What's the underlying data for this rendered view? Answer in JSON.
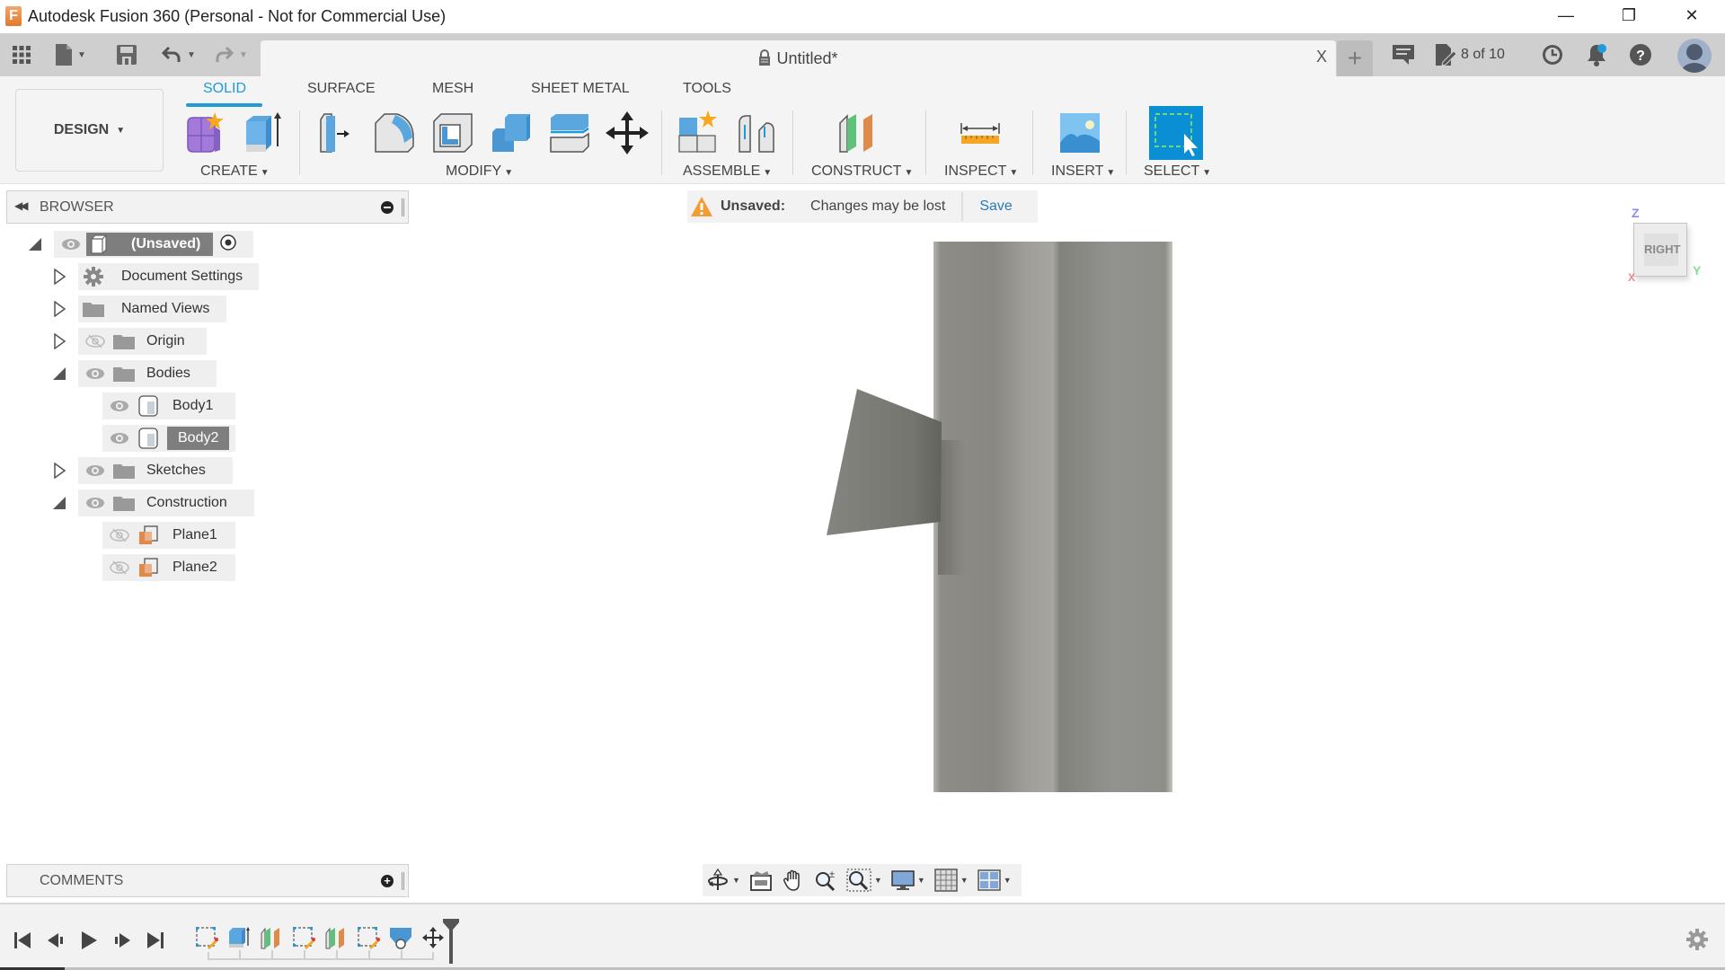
{
  "window": {
    "title": "Autodesk Fusion 360 (Personal - Not for Commercial Use)",
    "logo_letter": "F",
    "controls": {
      "minimize": "—",
      "restore": "❐",
      "close": "✕"
    }
  },
  "quick_access": {
    "icons": [
      "data-panel-grid-icon",
      "file-icon",
      "save-icon",
      "undo-icon",
      "redo-icon"
    ]
  },
  "document_tab": {
    "title": "Untitled*",
    "close": "X",
    "new_tab": "+"
  },
  "top_right": {
    "jobs_status": "8 of 10",
    "icons": [
      "comments-icon",
      "job-status-icon",
      "history-clock-icon",
      "notifications-bell-icon",
      "help-icon",
      "user-avatar"
    ]
  },
  "ribbon": {
    "workspace": "DESIGN",
    "tabs": [
      {
        "label": "SOLID",
        "active": true
      },
      {
        "label": "SURFACE",
        "active": false
      },
      {
        "label": "MESH",
        "active": false
      },
      {
        "label": "SHEET METAL",
        "active": false
      },
      {
        "label": "TOOLS",
        "active": false
      }
    ],
    "groups": [
      {
        "label": "CREATE",
        "tools": [
          "create-form-icon",
          "extrude-icon"
        ]
      },
      {
        "label": "MODIFY",
        "tools": [
          "press-pull-icon",
          "fillet-icon",
          "shell-icon",
          "combine-icon",
          "offset-face-icon",
          "move-copy-icon"
        ]
      },
      {
        "label": "ASSEMBLE",
        "tools": [
          "new-component-icon",
          "joint-icon"
        ]
      },
      {
        "label": "CONSTRUCT",
        "tools": [
          "offset-plane-icon"
        ]
      },
      {
        "label": "INSPECT",
        "tools": [
          "measure-icon"
        ]
      },
      {
        "label": "INSERT",
        "tools": [
          "insert-image-icon"
        ]
      },
      {
        "label": "SELECT",
        "tools": [
          "select-icon"
        ]
      }
    ]
  },
  "browser": {
    "title": "BROWSER",
    "root": {
      "label": "(Unsaved)",
      "expanded": true
    },
    "nodes": [
      {
        "label": "Document Settings",
        "expanded": false,
        "level": 1,
        "visible": null
      },
      {
        "label": "Named Views",
        "expanded": false,
        "level": 1,
        "visible": null
      },
      {
        "label": "Origin",
        "expanded": false,
        "level": 1,
        "visible": false
      },
      {
        "label": "Bodies",
        "expanded": true,
        "level": 1,
        "visible": true
      },
      {
        "label": "Body1",
        "level": 2,
        "visible": true,
        "selected": false
      },
      {
        "label": "Body2",
        "level": 2,
        "visible": true,
        "selected": true
      },
      {
        "label": "Sketches",
        "expanded": false,
        "level": 1,
        "visible": true
      },
      {
        "label": "Construction",
        "expanded": true,
        "level": 1,
        "visible": true
      },
      {
        "label": "Plane1",
        "level": 2,
        "visible": false
      },
      {
        "label": "Plane2",
        "level": 2,
        "visible": false
      }
    ]
  },
  "banner": {
    "label": "Unsaved:",
    "message": "Changes may be lost",
    "action": "Save"
  },
  "viewcube": {
    "face": "RIGHT",
    "axes": {
      "z": "Z",
      "y": "Y",
      "x": "X"
    }
  },
  "comments": {
    "title": "COMMENTS"
  },
  "nav_toolbar": {
    "icons": [
      "orbit-icon",
      "look-at-icon",
      "pan-hand-icon",
      "zoom-icon",
      "fit-window-icon",
      "display-settings-icon",
      "grid-snaps-icon",
      "viewports-icon"
    ]
  },
  "timeline": {
    "controls": [
      "first-icon",
      "previous-icon",
      "play-icon",
      "next-icon",
      "last-icon"
    ],
    "features": [
      "sketch",
      "extrude",
      "offset-plane",
      "sketch",
      "offset-plane",
      "sketch",
      "loft",
      "move"
    ]
  },
  "colors": {
    "accent": "#1e9cd7",
    "warning": "#f39c34",
    "link": "#2a7ab8",
    "plane_orange": "#e08a4a",
    "body_gray": "#8c8b84"
  }
}
